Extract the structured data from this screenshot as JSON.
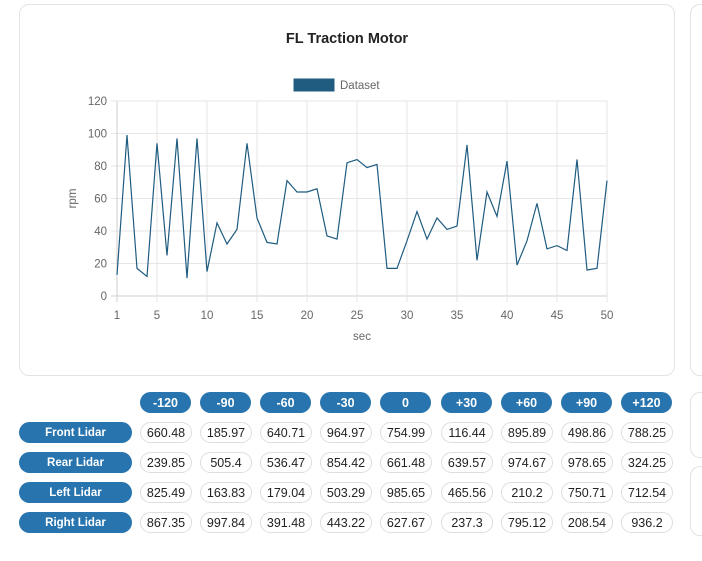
{
  "chart_data": {
    "type": "line",
    "title": "FL Traction Motor",
    "legend": [
      "Dataset"
    ],
    "legend_position": "top",
    "xlabel": "sec",
    "ylabel": "rpm",
    "xlim": [
      1,
      50
    ],
    "ylim": [
      0,
      120
    ],
    "x_ticks": [
      1,
      5,
      10,
      15,
      20,
      25,
      30,
      35,
      40,
      45,
      50
    ],
    "y_ticks": [
      0,
      20,
      40,
      60,
      80,
      100,
      120
    ],
    "grid": true,
    "color": "#1f5c80",
    "series": [
      {
        "name": "Dataset",
        "x": [
          1,
          2,
          3,
          4,
          5,
          6,
          7,
          8,
          9,
          10,
          11,
          12,
          13,
          14,
          15,
          16,
          17,
          18,
          19,
          20,
          21,
          22,
          23,
          24,
          25,
          26,
          27,
          28,
          29,
          30,
          31,
          32,
          33,
          34,
          35,
          36,
          37,
          38,
          39,
          40,
          41,
          42,
          43,
          44,
          45,
          46,
          47,
          48,
          49,
          50
        ],
        "values": [
          13,
          99,
          17,
          12,
          94,
          25,
          97,
          11,
          97,
          15,
          45,
          32,
          41,
          94,
          48,
          33,
          32,
          71,
          64,
          64,
          66,
          37,
          35,
          82,
          84,
          79,
          81,
          17,
          17,
          34,
          52,
          35,
          48,
          41,
          43,
          93,
          22,
          64,
          49,
          83,
          19,
          34,
          57,
          29,
          31,
          28,
          84,
          16,
          17,
          71
        ]
      }
    ]
  },
  "table": {
    "columns": [
      "-120",
      "-90",
      "-60",
      "-30",
      "0",
      "+30",
      "+60",
      "+90",
      "+120"
    ],
    "rows": [
      {
        "label": "Front Lidar",
        "values": [
          "660.48",
          "185.97",
          "640.71",
          "964.97",
          "754.99",
          "116.44",
          "895.89",
          "498.86",
          "788.25"
        ]
      },
      {
        "label": "Rear Lidar",
        "values": [
          "239.85",
          "505.4",
          "536.47",
          "854.42",
          "661.48",
          "639.57",
          "974.67",
          "978.65",
          "324.25"
        ]
      },
      {
        "label": "Left Lidar",
        "values": [
          "825.49",
          "163.83",
          "179.04",
          "503.29",
          "985.65",
          "465.56",
          "210.2",
          "750.71",
          "712.54"
        ]
      },
      {
        "label": "Right Lidar",
        "values": [
          "867.35",
          "997.84",
          "391.48",
          "443.22",
          "627.67",
          "237.3",
          "795.12",
          "208.54",
          "936.2"
        ]
      }
    ]
  }
}
